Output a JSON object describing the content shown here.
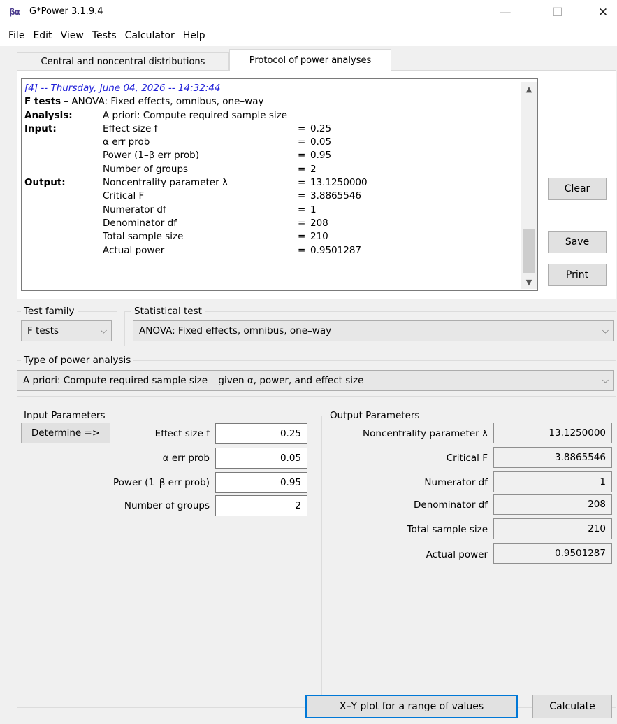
{
  "window": {
    "title": "G*Power 3.1.9.4",
    "icon_text": "βα",
    "minimize": "—",
    "maximize": "☐",
    "close": "✕"
  },
  "menu": [
    "File",
    "Edit",
    "View",
    "Tests",
    "Calculator",
    "Help"
  ],
  "tabs": [
    {
      "label": "Central and noncentral distributions",
      "active": false
    },
    {
      "label": "Protocol of power analyses",
      "active": true
    }
  ],
  "protocol": {
    "header": "[4] -- Thursday, June 04, 2026 -- 14:32:44",
    "test_prefix": "F tests",
    "test_suffix": " – ANOVA: Fixed effects, omnibus, one–way",
    "analysis_label": "Analysis:",
    "analysis_value": "A priori: Compute required sample size",
    "input_label": "Input:",
    "output_label": "Output:",
    "inputs": [
      {
        "name": "Effect size f",
        "value": "0.25"
      },
      {
        "name": "α err prob",
        "value": "0.05"
      },
      {
        "name": "Power (1–β err prob)",
        "value": "0.95"
      },
      {
        "name": "Number of groups",
        "value": "2"
      }
    ],
    "outputs": [
      {
        "name": "Noncentrality parameter λ",
        "value": "13.1250000"
      },
      {
        "name": "Critical F",
        "value": "3.8865546"
      },
      {
        "name": "Numerator df",
        "value": "1"
      },
      {
        "name": "Denominator df",
        "value": "208"
      },
      {
        "name": "Total sample size",
        "value": "210"
      },
      {
        "name": "Actual power",
        "value": "0.9501287"
      }
    ],
    "equals": "="
  },
  "side_buttons": {
    "clear": "Clear",
    "save": "Save",
    "print": "Print"
  },
  "test_family": {
    "label": "Test family",
    "value": "F tests"
  },
  "statistical_test": {
    "label": "Statistical test",
    "value": "ANOVA: Fixed effects, omnibus, one–way"
  },
  "power_analysis": {
    "label": "Type of power analysis",
    "value": "A priori: Compute required sample size – given α, power, and effect size"
  },
  "input_params": {
    "label": "Input Parameters",
    "determine": "Determine =>",
    "fields": [
      {
        "label": "Effect size f",
        "value": "0.25"
      },
      {
        "label": "α err prob",
        "value": "0.05"
      },
      {
        "label": "Power (1–β err prob)",
        "value": "0.95"
      },
      {
        "label": "Number of groups",
        "value": "2"
      }
    ]
  },
  "output_params": {
    "label": "Output Parameters",
    "fields": [
      {
        "label": "Noncentrality parameter λ",
        "value": "13.1250000"
      },
      {
        "label": "Critical F",
        "value": "3.8865546"
      },
      {
        "label": "Numerator df",
        "value": "1"
      },
      {
        "label": "Denominator df",
        "value": "208"
      },
      {
        "label": "Total sample size",
        "value": "210"
      },
      {
        "label": "Actual power",
        "value": "0.9501287"
      }
    ]
  },
  "bottom_buttons": {
    "xy_plot": "X–Y plot for a range of values",
    "calculate": "Calculate"
  }
}
